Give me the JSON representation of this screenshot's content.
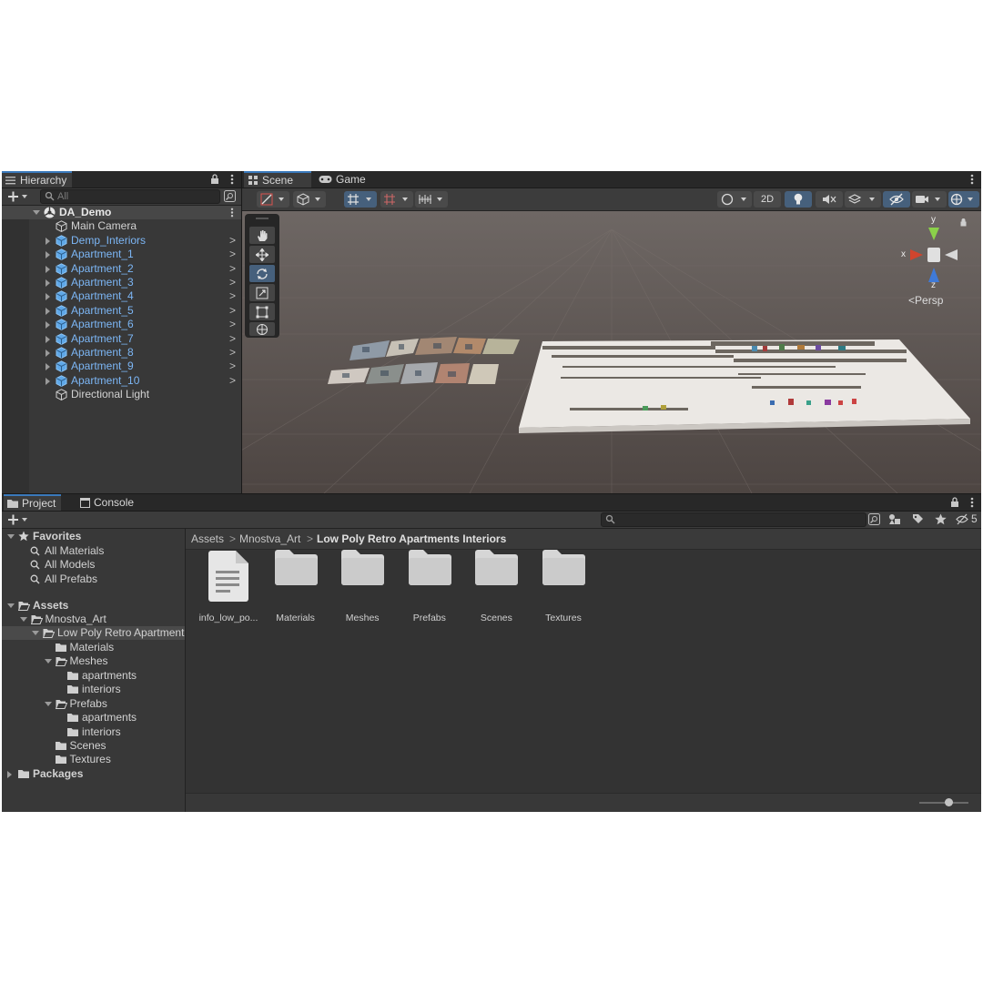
{
  "hierarchy": {
    "tab_label": "Hierarchy",
    "search_placeholder": "All",
    "scene_name": "DA_Demo",
    "items": [
      {
        "label": "Main Camera",
        "prefab": false,
        "expandable": false
      },
      {
        "label": "Demp_Interiors",
        "prefab": true,
        "expandable": true
      },
      {
        "label": "Apartment_1",
        "prefab": true,
        "expandable": true
      },
      {
        "label": "Apartment_2",
        "prefab": true,
        "expandable": true
      },
      {
        "label": "Apartment_3",
        "prefab": true,
        "expandable": true
      },
      {
        "label": "Apartment_4",
        "prefab": true,
        "expandable": true
      },
      {
        "label": "Apartment_5",
        "prefab": true,
        "expandable": true
      },
      {
        "label": "Apartment_6",
        "prefab": true,
        "expandable": true
      },
      {
        "label": "Apartment_7",
        "prefab": true,
        "expandable": true
      },
      {
        "label": "Apartment_8",
        "prefab": true,
        "expandable": true
      },
      {
        "label": "Apartment_9",
        "prefab": true,
        "expandable": true
      },
      {
        "label": "Apartment_10",
        "prefab": true,
        "expandable": true
      },
      {
        "label": "Directional Light",
        "prefab": false,
        "expandable": false
      }
    ]
  },
  "scene_tabs": {
    "scene": "Scene",
    "game": "Game"
  },
  "scene_toolbar": {
    "mode_2d": "2D"
  },
  "gizmo": {
    "x": "x",
    "y": "y",
    "z": "z",
    "projection": "Persp"
  },
  "project": {
    "tabs": {
      "project": "Project",
      "console": "Console"
    },
    "hidden_count": "5",
    "favorites": {
      "label": "Favorites",
      "items": [
        "All Materials",
        "All Models",
        "All Prefabs"
      ]
    },
    "tree": {
      "assets": "Assets",
      "mnostva": "Mnostva_Art",
      "low_poly": "Low Poly Retro Apartment",
      "materials": "Materials",
      "meshes": "Meshes",
      "meshes_apartments": "apartments",
      "meshes_interiors": "interiors",
      "prefabs": "Prefabs",
      "prefabs_apartments": "apartments",
      "prefabs_interiors": "interiors",
      "scenes": "Scenes",
      "textures": "Textures",
      "packages": "Packages"
    },
    "breadcrumb": [
      "Assets",
      "Mnostva_Art",
      "Low Poly Retro Apartments Interiors"
    ],
    "assets": [
      {
        "name": "info_low_po...",
        "kind": "file-icon"
      },
      {
        "name": "Materials",
        "kind": "folder-icon"
      },
      {
        "name": "Meshes",
        "kind": "folder-icon"
      },
      {
        "name": "Prefabs",
        "kind": "folder-icon"
      },
      {
        "name": "Scenes",
        "kind": "folder-icon"
      },
      {
        "name": "Textures",
        "kind": "folder-icon"
      }
    ]
  },
  "colors": {
    "accent": "#3a79bb",
    "prefab_text": "#7cb6f5",
    "viewport_bg": "#5b5350"
  }
}
